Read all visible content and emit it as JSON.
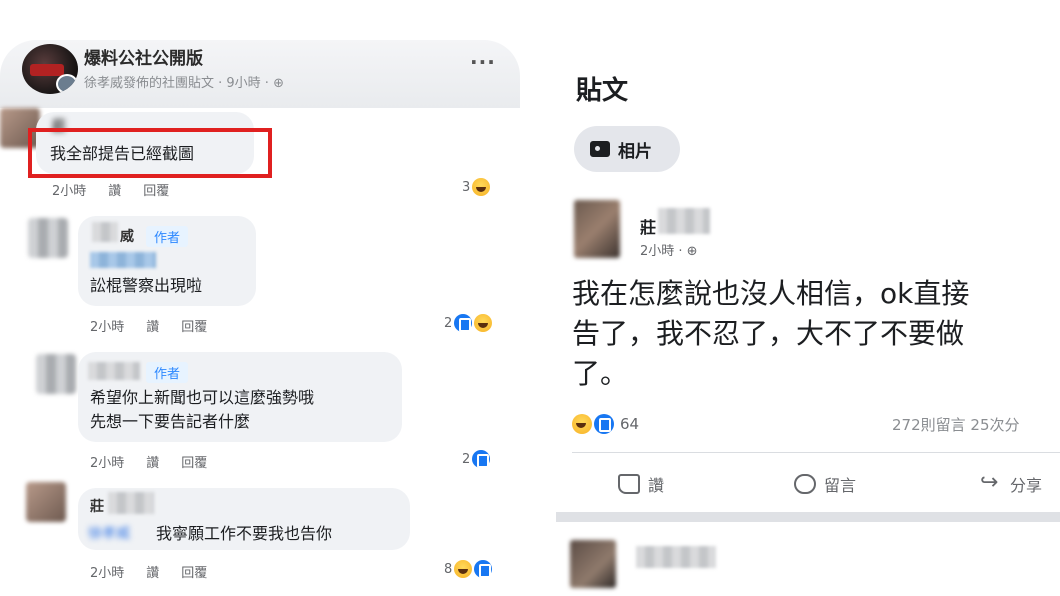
{
  "left": {
    "group": {
      "name": "爆料公社公開版",
      "subtitle": "徐孝威發佈的社團貼文 · 9小時 · ⊕",
      "more": "···"
    },
    "comments": [
      {
        "name": "莊",
        "text": "我全部提告已經截圖",
        "meta": [
          "2小時",
          "讚",
          "回覆"
        ],
        "reaction_count": "3",
        "reactions": [
          "haha"
        ],
        "highlighted": true
      },
      {
        "name": "威",
        "badge": "作者",
        "text": "訟棍警察出現啦",
        "meta": [
          "2小時",
          "讚",
          "回覆"
        ],
        "reaction_count": "2",
        "reactions": [
          "like",
          "haha"
        ]
      },
      {
        "name": "",
        "badge": "作者",
        "text": "希望你上新聞也可以這麼強勢哦\n先想一下要告記者什麼",
        "meta": [
          "2小時",
          "讚",
          "回覆"
        ],
        "reaction_count": "2",
        "reactions": [
          "like"
        ]
      },
      {
        "name": "莊",
        "mention": "徐孝威",
        "text": "我寧願工作不要我也告你",
        "meta": [
          "2小時",
          "讚",
          "回覆"
        ],
        "reaction_count": "8",
        "reactions": [
          "haha",
          "like"
        ]
      }
    ]
  },
  "right": {
    "title": "貼文",
    "chip_label": "相片",
    "post": {
      "author": "莊",
      "time": "2小時 · ⊕",
      "text": "我在怎麼說也沒人相信，ok直接\n告了，我不忍了，大不了不要做\n了。",
      "reaction_count": "64",
      "stats": "272則留言  25次分",
      "actions": {
        "like": "讚",
        "comment": "留言",
        "share": "分享"
      }
    }
  },
  "colors": {
    "highlight_border": "#e02020",
    "author_badge": "#2d88ff",
    "like_blue": "#1877f2",
    "haha_yellow": "#f7b125"
  }
}
